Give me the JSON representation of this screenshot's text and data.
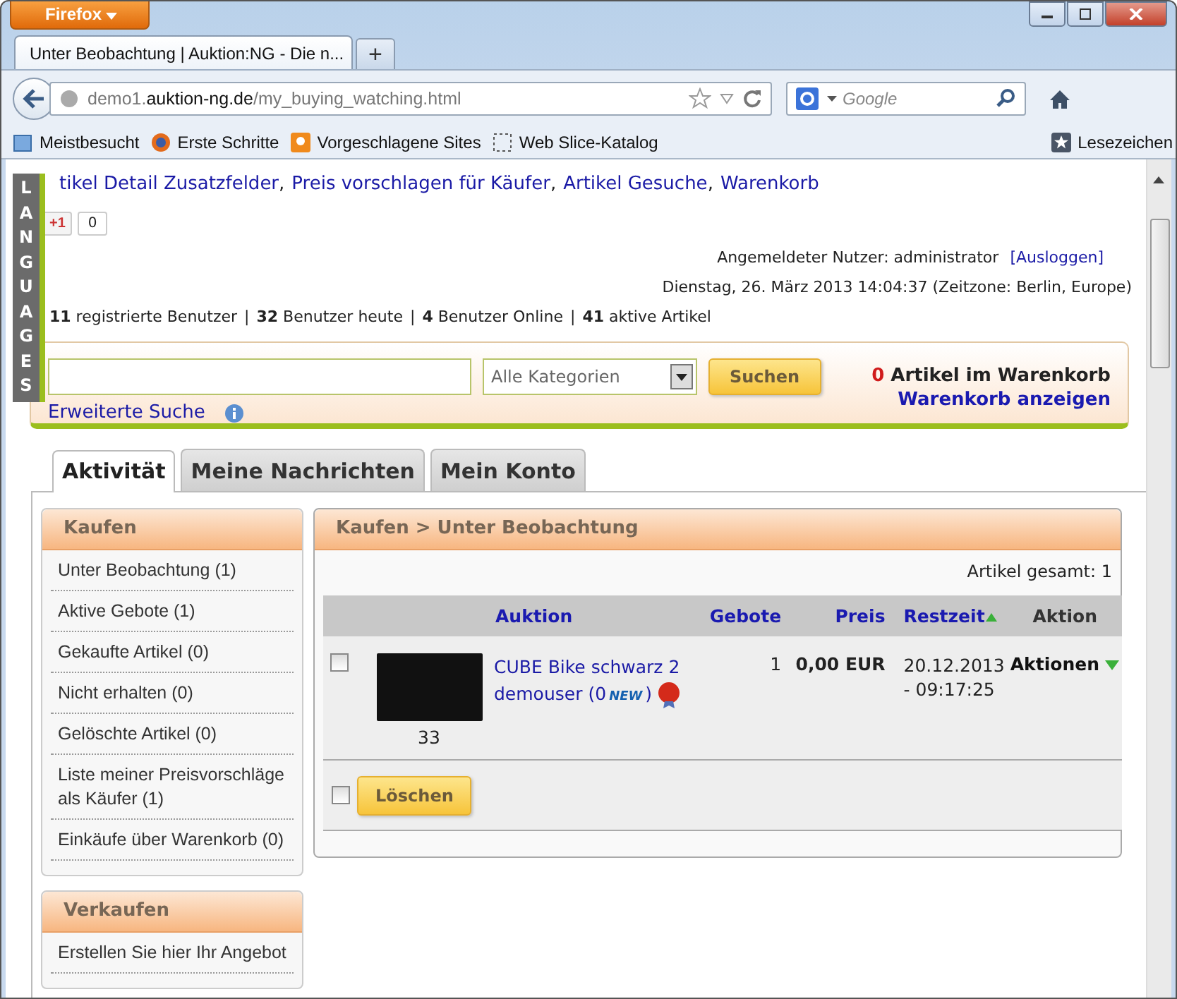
{
  "browser": {
    "menu_button": "Firefox",
    "tab_title": "Unter Beobachtung | Auktion:NG - Die n...",
    "new_tab": "+",
    "url": {
      "prefix": "demo1.",
      "domain": "auktion-ng.de",
      "path": "/my_buying_watching.html"
    },
    "search_placeholder": "Google",
    "bookmarks": [
      {
        "label": "Meistbesucht",
        "kind": "folder"
      },
      {
        "label": "Erste Schritte",
        "kind": "firefox"
      },
      {
        "label": "Vorgeschlagene Sites",
        "kind": "suggest"
      },
      {
        "label": "Web Slice-Katalog",
        "kind": "slice"
      }
    ],
    "bookmarks_menu": "Lesezeichen"
  },
  "page": {
    "languages": "LANGUAGES",
    "module_links": [
      "tikel Detail Zusatzfelder",
      "Preis vorschlagen für Käufer",
      "Artikel Gesuche",
      "Warenkorb"
    ],
    "link_separator": ",",
    "stats_separator": "|",
    "plus_one": "+1",
    "plus_count": "0",
    "user_label": "Angemeldeter Nutzer: administrator",
    "logout": "[Ausloggen]",
    "date": "Dienstag, 26. März 2013 14:04:37 (Zeitzone: Berlin, Europe)",
    "stats": [
      {
        "count": "11",
        "label": "registrierte Benutzer"
      },
      {
        "count": "32",
        "label": "Benutzer heute"
      },
      {
        "count": "4",
        "label": "Benutzer Online"
      },
      {
        "count": "41",
        "label": "aktive Artikel"
      }
    ],
    "search": {
      "category": "Alle Kategorien",
      "button": "Suchen",
      "advanced": "Erweiterte Suche",
      "cart_count": "0",
      "cart_label": "Artikel im Warenkorb",
      "cart_link": "Warenkorb anzeigen"
    },
    "tabs": [
      {
        "label": "Aktivität",
        "selected": true
      },
      {
        "label": "Meine Nachrichten",
        "selected": false
      },
      {
        "label": "Mein Konto",
        "selected": false
      }
    ],
    "sidebar": [
      {
        "title": "Kaufen",
        "items": [
          "Unter Beobachtung (1)",
          "Aktive Gebote (1)",
          "Gekaufte Artikel (0)",
          "Nicht erhalten (0)",
          "Gelöschte Artikel (0)",
          "Liste meiner Preisvorschläge als Käufer (1)",
          "Einkäufe über Warenkorb (0)"
        ]
      },
      {
        "title": "Verkaufen",
        "items": [
          "Erstellen Sie hier Ihr Angebot"
        ]
      }
    ],
    "main": {
      "breadcrumb": "Kaufen > Unter Beobachtung",
      "total": "Artikel gesamt: 1",
      "columns": [
        {
          "label": "Auktion",
          "kind": "link",
          "sorted": false
        },
        {
          "label": "Gebote",
          "kind": "link",
          "sorted": false
        },
        {
          "label": "Preis",
          "kind": "link",
          "sorted": false
        },
        {
          "label": "Restzeit",
          "kind": "link",
          "sorted": true
        },
        {
          "label": "Aktion",
          "kind": "plain",
          "sorted": false
        }
      ],
      "rows": [
        {
          "checked": false,
          "image_caption": "33",
          "title": "CUBE Bike schwarz 2",
          "seller": "demouser",
          "rating_open": "(0",
          "badge": "NEW",
          "rating_close": ")",
          "bids": "1",
          "price": "0,00 EUR",
          "end_date": "20.12.2013",
          "end_time": "- 09:17:25",
          "action": "Aktionen"
        }
      ],
      "select_all": {
        "checked": false
      },
      "delete_button": "Löschen"
    }
  }
}
